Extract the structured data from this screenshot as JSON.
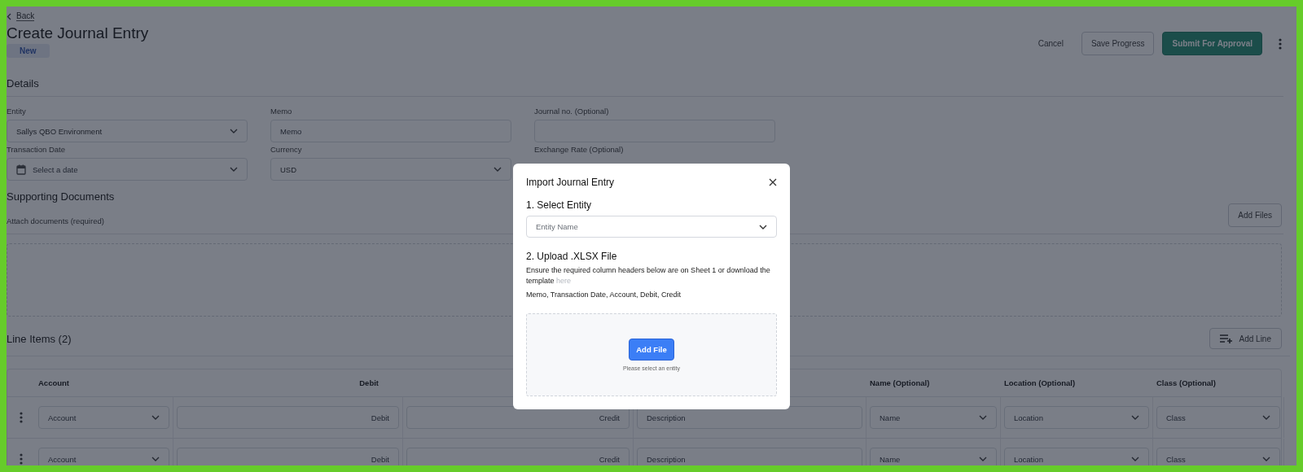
{
  "header": {
    "back": "Back",
    "title": "Create Journal Entry",
    "status_badge": "New"
  },
  "actions": {
    "cancel": "Cancel",
    "save": "Save Progress",
    "submit": "Submit For Approval"
  },
  "details": {
    "title": "Details",
    "fields": [
      {
        "label": "Entity",
        "kind": "select",
        "value": "Sallys QBO Environment"
      },
      {
        "label": "Memo",
        "kind": "input",
        "placeholder": "Memo"
      },
      {
        "label": "Journal no. (Optional)",
        "kind": "input"
      },
      {
        "label": "Transaction Date",
        "kind": "date",
        "placeholder": "Select a date"
      },
      {
        "label": "Currency",
        "kind": "select",
        "value": "USD"
      },
      {
        "label": "Exchange Rate (Optional)",
        "kind": "covered"
      }
    ]
  },
  "supporting_documents": {
    "title": "Supporting Documents",
    "hint": "Attach documents (required)",
    "add_button": "Add Files"
  },
  "line_items": {
    "title": "Line Items (2)",
    "add_button": "Add Line",
    "columns": [
      {
        "header": "Account",
        "kind": "select"
      },
      {
        "header": "Debit",
        "kind": "amount"
      },
      {
        "kind": "amount"
      },
      {
        "kind": "text"
      },
      {
        "header": "Name (Optional)",
        "kind": "select"
      },
      {
        "header": "Location (Optional)",
        "kind": "select"
      },
      {
        "header": "Class (Optional)",
        "kind": "select"
      }
    ],
    "rows": [
      {
        "placeholders": [
          "Account",
          "Debit",
          "Credit",
          "Description",
          "Name",
          "Location",
          "Class"
        ]
      },
      {
        "placeholders": [
          "Account",
          "Debit",
          "Credit",
          "Description",
          "Name",
          "Location",
          "Class"
        ]
      }
    ]
  },
  "modal": {
    "title": "Import Journal Entry",
    "step1": "1. Select Entity",
    "entity_placeholder": "Entity Name",
    "step2": "2. Upload .XLSX File",
    "instructions": "Ensure the required column headers below are on Sheet 1 or download the template",
    "link": "here",
    "columns_text": "Memo, Transaction Date, Account, Debit, Credit",
    "add_file": "Add File",
    "dropzone_hint": "Please select an entity"
  }
}
